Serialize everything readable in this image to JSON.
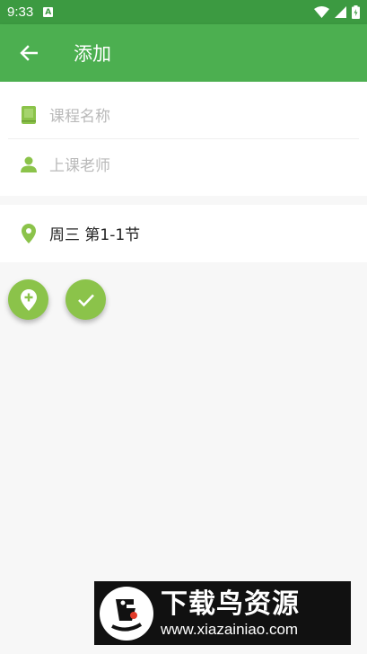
{
  "status_bar": {
    "time": "9:33",
    "notification": "A"
  },
  "app_bar": {
    "title": "添加"
  },
  "form": {
    "course_name_placeholder": "课程名称",
    "teacher_placeholder": "上课老师"
  },
  "schedule": {
    "time_label": "周三 第1-1节"
  },
  "fab": {
    "add_location_icon": "add-location-icon",
    "confirm_icon": "check-icon"
  },
  "watermark": {
    "title": "下载鸟资源",
    "url": "www.xiazainiao.com"
  },
  "colors": {
    "status_bar": "#3c9a41",
    "app_bar": "#4caf50",
    "accent": "#8bc34a",
    "icon_green": "#8bc34a"
  }
}
